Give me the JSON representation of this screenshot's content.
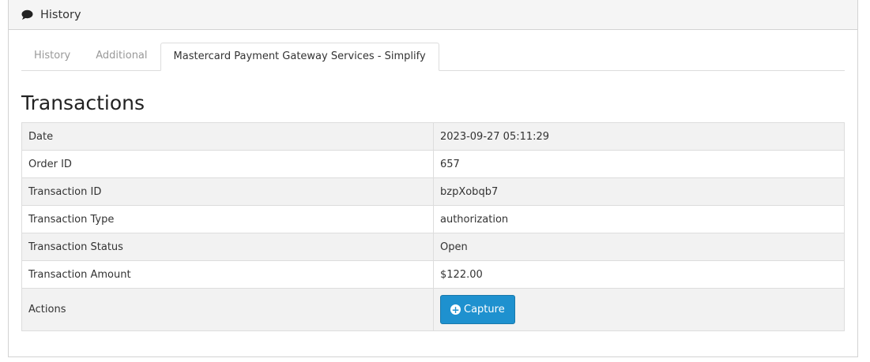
{
  "panel": {
    "title": "History",
    "icon": "comment-icon"
  },
  "tabs": [
    {
      "label": "History",
      "active": false
    },
    {
      "label": "Additional",
      "active": false
    },
    {
      "label": "Mastercard Payment Gateway Services - Simplify",
      "active": true
    }
  ],
  "section": {
    "title": "Transactions"
  },
  "transaction": {
    "rows": [
      {
        "label": "Date",
        "value": "2023-09-27 05:11:29"
      },
      {
        "label": "Order ID",
        "value": "657"
      },
      {
        "label": "Transaction ID",
        "value": "bzpXobqb7"
      },
      {
        "label": "Transaction Type",
        "value": "authorization"
      },
      {
        "label": "Transaction Status",
        "value": "Open"
      },
      {
        "label": "Transaction Amount",
        "value": "$122.00"
      }
    ],
    "actions_label": "Actions",
    "capture_button": {
      "label": "Capture",
      "icon": "plus-circle-icon"
    }
  },
  "colors": {
    "accent": "#1e91cf",
    "stripe": "#f2f2f2",
    "border": "#dddddd"
  }
}
